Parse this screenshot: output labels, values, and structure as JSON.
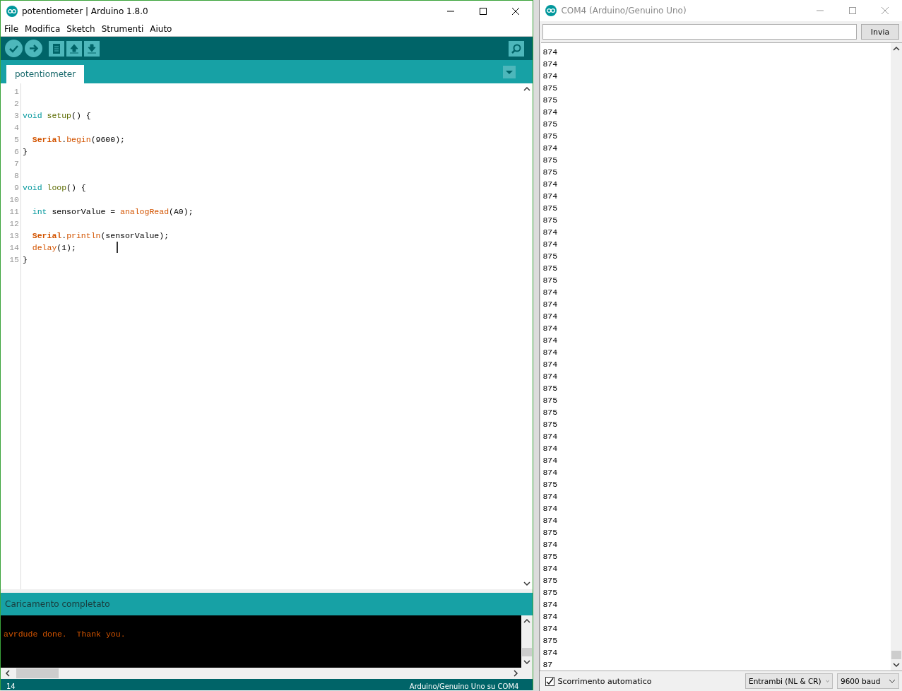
{
  "ide": {
    "title": "potentiometer | Arduino 1.8.0",
    "menu": [
      "File",
      "Modifica",
      "Sketch",
      "Strumenti",
      "Aiuto"
    ],
    "tabs": [
      {
        "label": "potentiometer",
        "selected": true
      }
    ],
    "code": [
      {
        "num": "1"
      },
      {
        "num": "2"
      },
      {
        "num": "3",
        "indented": false,
        "tokens": [
          {
            "text": "void",
            "kind": "type",
            "space_before": false
          },
          {
            "text": "setup",
            "kind": "func",
            "space_before": true
          },
          {
            "text": "() {",
            "kind": "plain",
            "space_before": false
          }
        ]
      },
      {
        "num": "4"
      },
      {
        "num": "5",
        "indented": true,
        "tokens": [
          {
            "text": "Serial",
            "kind": "object",
            "space_before": false
          },
          {
            "text": ".",
            "kind": "plain",
            "space_before": false
          },
          {
            "text": "begin",
            "kind": "method",
            "space_before": false
          },
          {
            "text": "(9600);",
            "kind": "plain",
            "space_before": false
          }
        ]
      },
      {
        "num": "6",
        "indented": false,
        "tokens": [
          {
            "text": "}",
            "kind": "plain",
            "space_before": false
          }
        ]
      },
      {
        "num": "7"
      },
      {
        "num": "8"
      },
      {
        "num": "9",
        "indented": false,
        "tokens": [
          {
            "text": "void",
            "kind": "type",
            "space_before": false
          },
          {
            "text": "loop",
            "kind": "func",
            "space_before": true
          },
          {
            "text": "() {",
            "kind": "plain",
            "space_before": false
          }
        ]
      },
      {
        "num": "10"
      },
      {
        "num": "11",
        "indented": true,
        "tokens": [
          {
            "text": "int",
            "kind": "type",
            "space_before": false
          },
          {
            "text": "sensorValue =",
            "kind": "plain",
            "space_before": true
          },
          {
            "text": "analogRead",
            "kind": "method",
            "space_before": true
          },
          {
            "text": "(A0);",
            "kind": "plain",
            "space_before": false
          }
        ]
      },
      {
        "num": "12"
      },
      {
        "num": "13",
        "indented": true,
        "tokens": [
          {
            "text": "Serial",
            "kind": "object",
            "space_before": false
          },
          {
            "text": ".",
            "kind": "plain",
            "space_before": false
          },
          {
            "text": "println",
            "kind": "method",
            "space_before": false
          },
          {
            "text": "(sensorValue);",
            "kind": "plain",
            "space_before": false
          }
        ]
      },
      {
        "num": "14",
        "indented": true,
        "tokens": [
          {
            "text": "delay",
            "kind": "method",
            "space_before": false
          },
          {
            "text": "(1);",
            "kind": "plain",
            "space_before": false
          }
        ]
      },
      {
        "num": "15",
        "indented": false,
        "tokens": [
          {
            "text": "}",
            "kind": "plain",
            "space_before": false
          }
        ]
      }
    ],
    "status_message": "Caricamento completato",
    "console_lines": [
      "avrdude done.  Thank you."
    ],
    "status_bar": {
      "line": "14",
      "board": "Arduino/Genuino Uno su COM4"
    }
  },
  "serial_monitor": {
    "title": "COM4 (Arduino/Genuino Uno)",
    "send_button": "Invia",
    "output": [
      "874",
      "874",
      "874",
      "875",
      "875",
      "874",
      "875",
      "875",
      "874",
      "875",
      "875",
      "874",
      "874",
      "875",
      "875",
      "874",
      "874",
      "875",
      "875",
      "875",
      "874",
      "874",
      "874",
      "874",
      "874",
      "874",
      "874",
      "874",
      "875",
      "875",
      "875",
      "875",
      "874",
      "874",
      "874",
      "874",
      "875",
      "874",
      "874",
      "874",
      "875",
      "874",
      "875",
      "874",
      "875",
      "875",
      "874",
      "874",
      "874",
      "875",
      "874",
      "87"
    ],
    "autoscroll": {
      "label": "Scorrimento automatico",
      "checked": true
    },
    "line_ending": "Entrambi (NL & CR)",
    "baud": "9600 baud"
  }
}
